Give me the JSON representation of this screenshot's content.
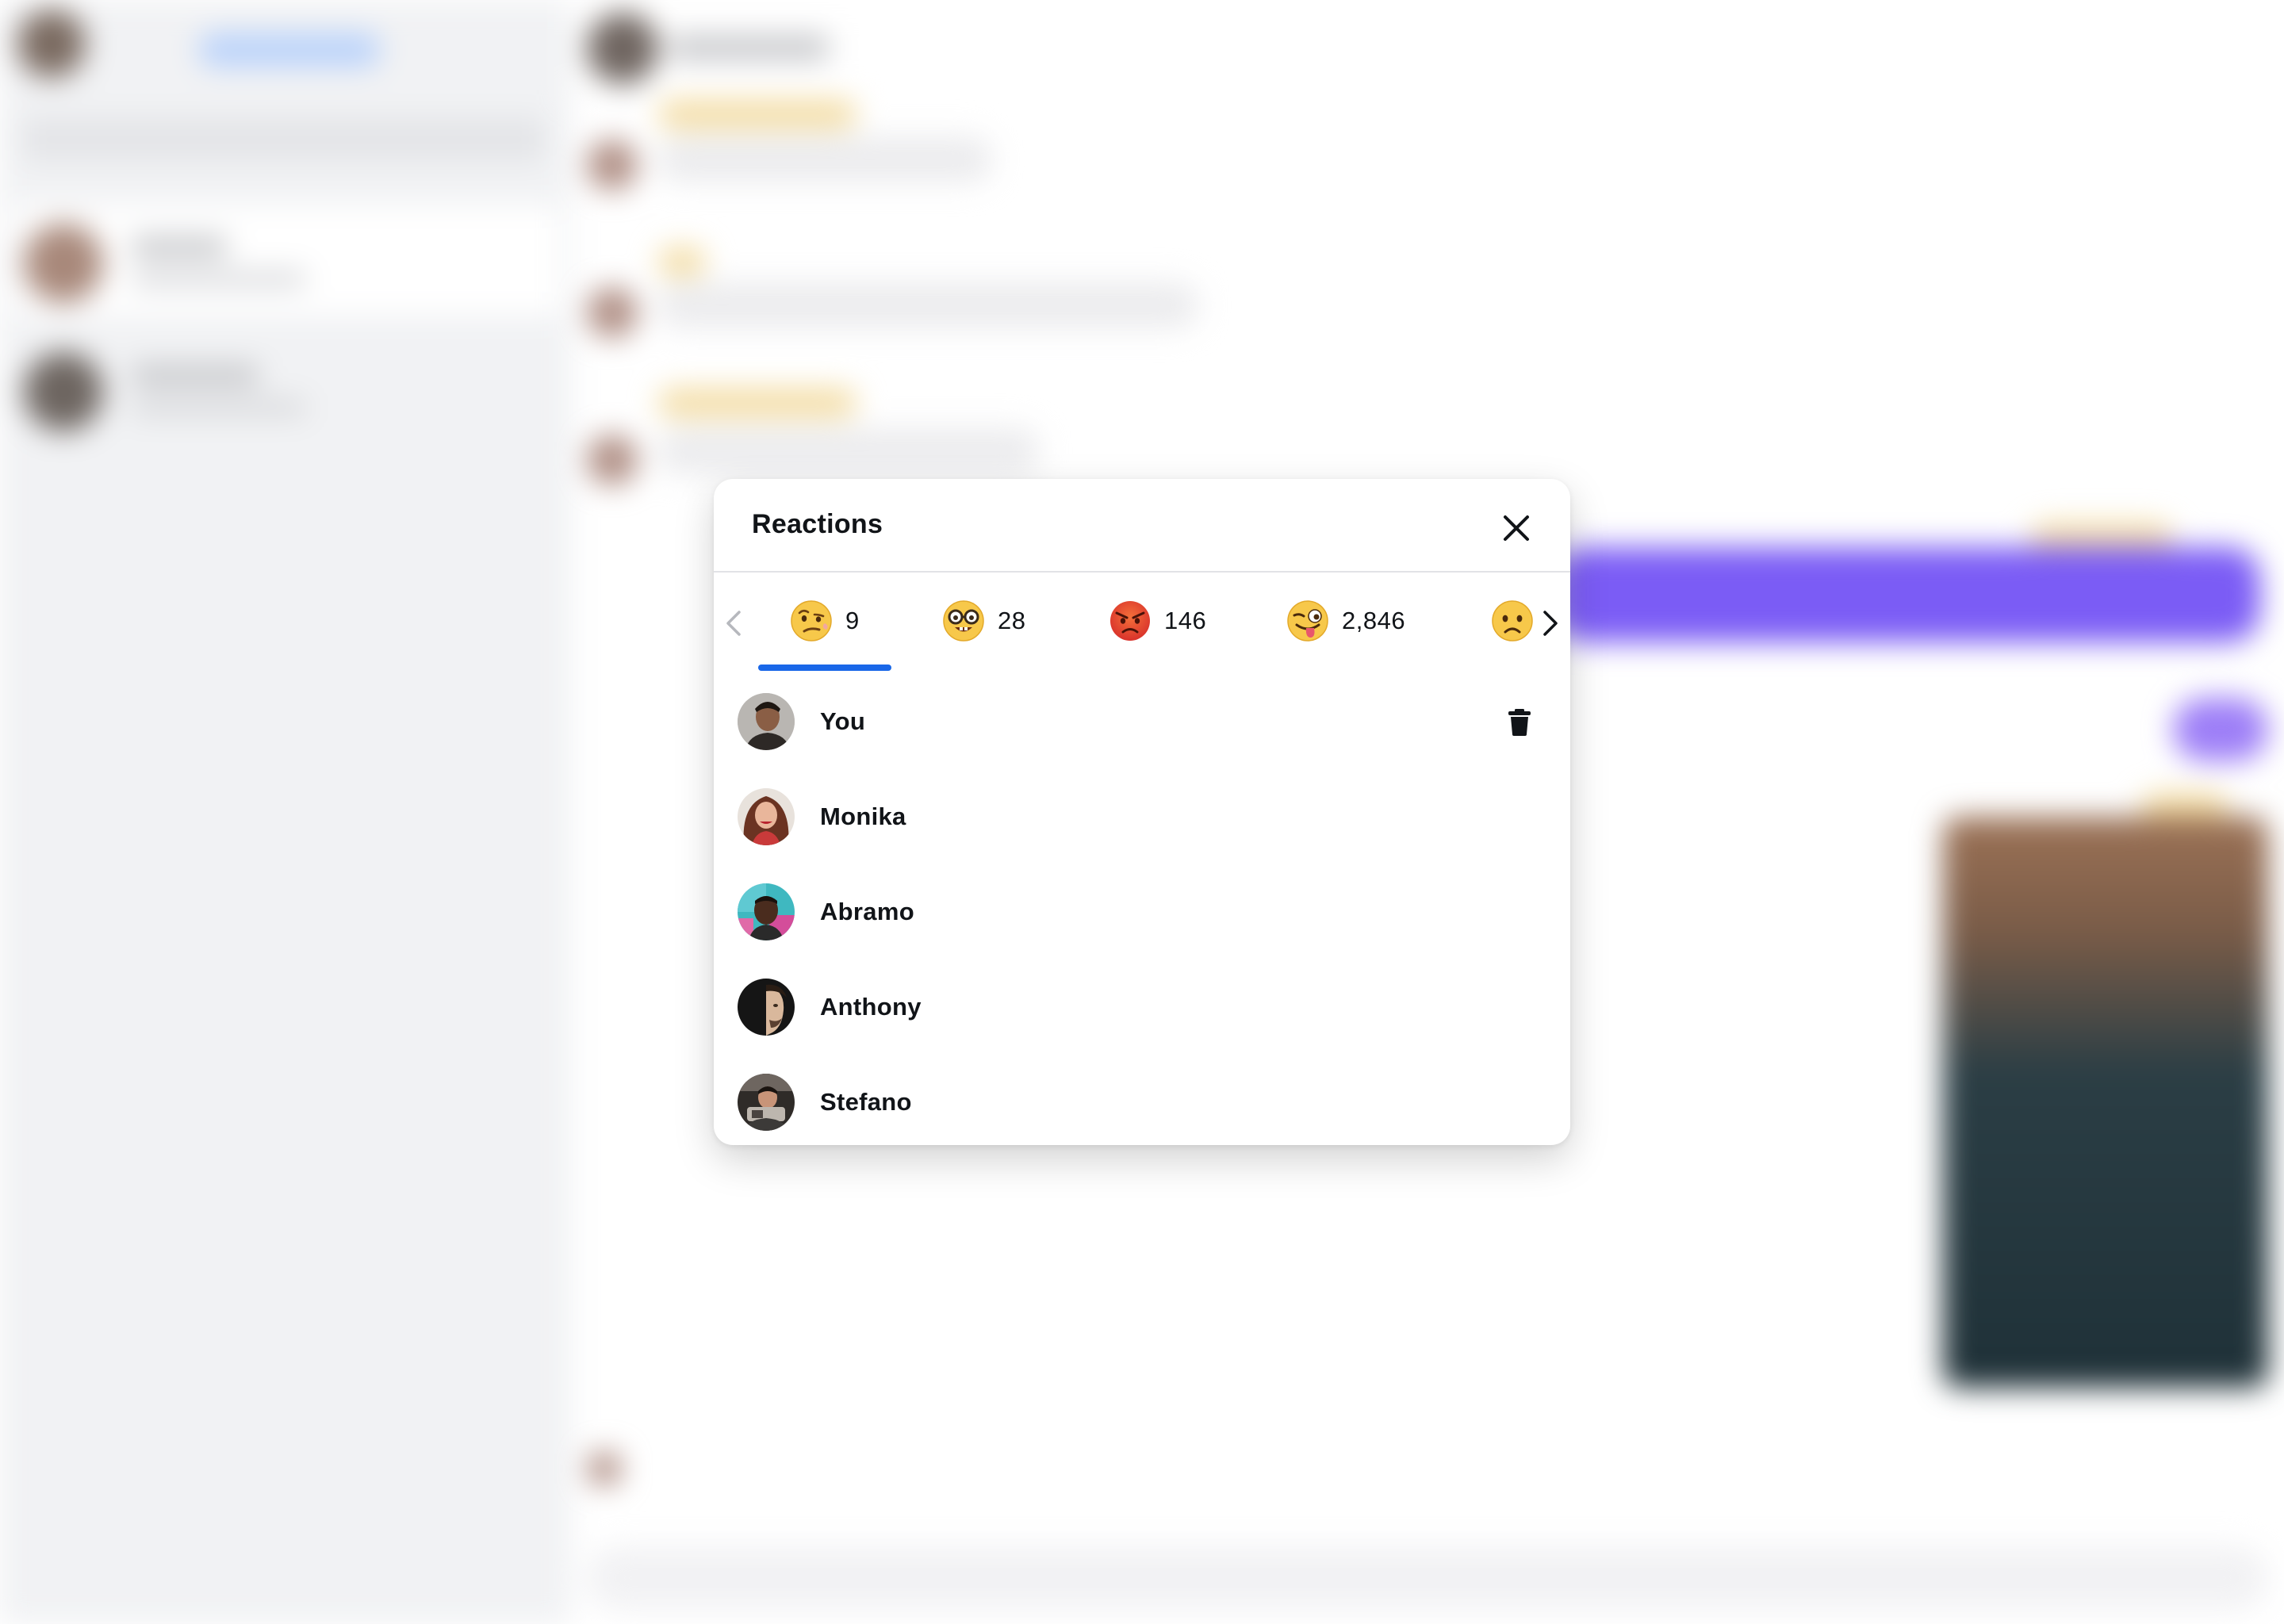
{
  "modal": {
    "title": "Reactions",
    "close_icon": "close-icon",
    "prev_icon": "chevron-left-icon",
    "next_icon": "chevron-right-icon",
    "active_tab_color": "#1967e8",
    "tabs": [
      {
        "emoji": "face-with-raised-eyebrow-pensive",
        "count": "9",
        "active": true
      },
      {
        "emoji": "nerd-face",
        "count": "28",
        "active": false
      },
      {
        "emoji": "angry-face",
        "count": "146",
        "active": false
      },
      {
        "emoji": "winking-face-with-tongue",
        "count": "2,846",
        "active": false
      },
      {
        "emoji": "frowning-face",
        "count": "",
        "active": false
      }
    ],
    "users": [
      {
        "name": "You",
        "avatar": "avatar-you",
        "removable": true,
        "remove_icon": "trash-icon"
      },
      {
        "name": "Monika",
        "avatar": "avatar-monika",
        "removable": false
      },
      {
        "name": "Abramo",
        "avatar": "avatar-abramo",
        "removable": false
      },
      {
        "name": "Anthony",
        "avatar": "avatar-anthony",
        "removable": false
      },
      {
        "name": "Stefano",
        "avatar": "avatar-stefano",
        "removable": false
      }
    ]
  },
  "background": {
    "accent_color": "#7b5cf5",
    "sidebar_color": "#f1f2f4"
  }
}
